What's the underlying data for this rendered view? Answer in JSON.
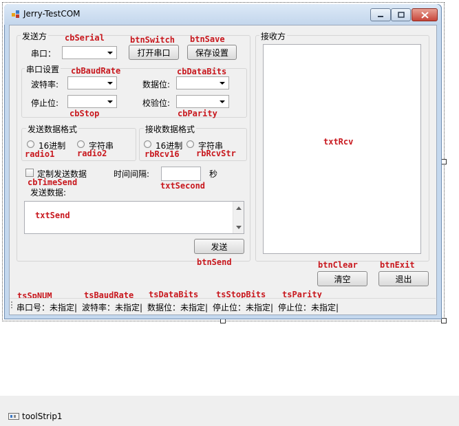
{
  "window": {
    "title": "Jerry-TestCOM",
    "controls": {
      "minimize": "minimize",
      "maximize": "maximize",
      "close": "close"
    }
  },
  "send_group": {
    "title": "发送方",
    "serial_label": "串口：",
    "serial_value": "",
    "btn_switch": "打开串口",
    "btn_save": "保存设置",
    "settings": {
      "title": "串口设置",
      "baud_label": "波特率:",
      "baud_value": "",
      "databits_label": "数据位:",
      "databits_value": "",
      "stop_label": "停止位:",
      "stop_value": "",
      "parity_label": "校验位:",
      "parity_value": ""
    },
    "send_format": {
      "title": "发送数据格式",
      "hex": "16进制",
      "str": "字符串"
    },
    "recv_format": {
      "title": "接收数据格式",
      "hex": "16进制",
      "str": "字符串"
    },
    "timed_send_label": "定制发送数据",
    "interval_label": "时间间隔:",
    "interval_value": "",
    "seconds_unit": "秒",
    "send_data_label": "发送数据:",
    "txt_send": "txtSend",
    "btn_send": "发送"
  },
  "recv_group": {
    "title": "接收方",
    "txt_rcv": "txtRcv"
  },
  "buttons": {
    "clear": "清空",
    "exit": "退出"
  },
  "annotations": {
    "cbSerial": "cbSerial",
    "btnSwitch": "btnSwitch",
    "btnSave": "btnSave",
    "cbBaudRate": "cbBaudRate",
    "cbDataBits": "cbDataBits",
    "cbStop": "cbStop",
    "cbParity": "cbParity",
    "radio1": "radio1",
    "radio2": "radio2",
    "rbRcv16": "rbRcv16",
    "rbRcvStr": "rbRcvStr",
    "cbTimeSend": "cbTimeSend",
    "txtSecond": "txtSecond",
    "btnSend": "btnSend",
    "btnClear": "btnClear",
    "btnExit": "btnExit",
    "tsSpNUM": "tsSpNUM",
    "tsBaudRate": "tsBaudRate",
    "tsDataBits": "tsDataBits",
    "tsStopBits": "tsStopBits",
    "tsParity": "tsParity"
  },
  "statusbar": {
    "port": "串口号：未指定|",
    "baud": "波特率：未指定|",
    "databits": "数据位：未指定|",
    "stopbits": "停止位：未指定|",
    "parity": "停止位：未指定|"
  },
  "component_tray": {
    "toolstrip": "toolStrip1"
  },
  "colors": {
    "annotation": "#c8171d",
    "window_frame": "#c4d8ee",
    "client": "#f0f0f0"
  }
}
